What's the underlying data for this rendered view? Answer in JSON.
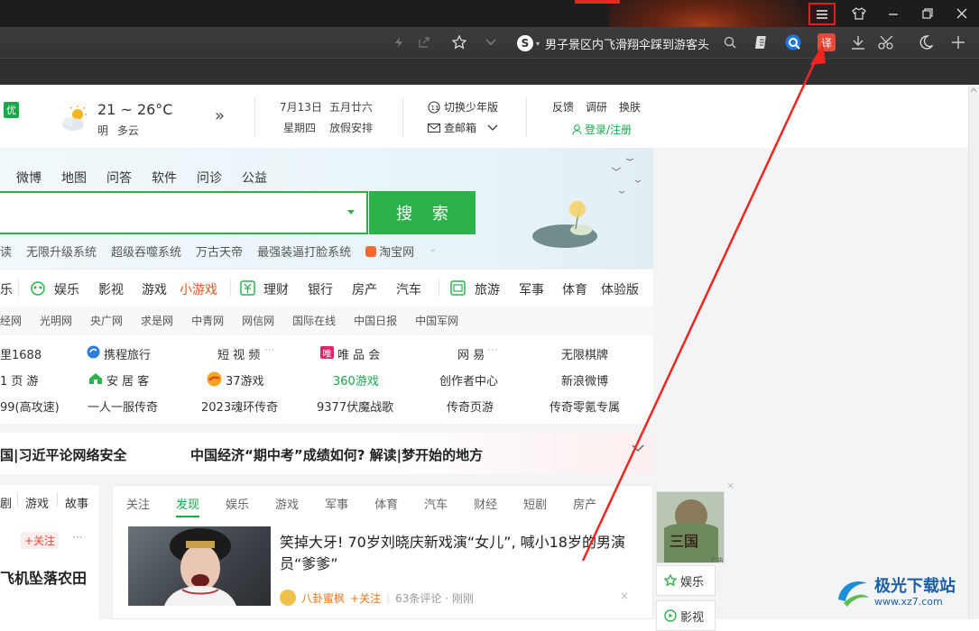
{
  "toolbar": {
    "news_ticker": "男子景区内飞滑翔伞踩到游客头",
    "translate_label": "译"
  },
  "top_info": {
    "badge": "优",
    "temp": "21 ~ 26°C",
    "tomorrow": "明  多云",
    "expand": "»",
    "date": "7月13日",
    "lunar": "五月廿六",
    "weekday": "星期四",
    "suit": "放假安排",
    "teen_mode": "切换少年版",
    "mail": "查邮箱",
    "feedback": "反馈",
    "survey": "调研",
    "skin": "换肤",
    "login": "登录/注册"
  },
  "search": {
    "tabs": [
      "微博",
      "地图",
      "问答",
      "软件",
      "问诊",
      "公益"
    ],
    "button": "搜 索",
    "hot_words": [
      "读",
      "无限升级系统",
      "超级吞噬系统",
      "万古天帝",
      "最强装逼打脸系统",
      "淘宝网"
    ]
  },
  "categories": {
    "c0": "乐",
    "c1": "娱乐",
    "c2": "影视",
    "c3": "游戏",
    "c4": "小游戏",
    "c5": "理财",
    "c6": "银行",
    "c7": "房产",
    "c8": "汽车",
    "c9": "旅游",
    "c10": "军事",
    "c11": "体育",
    "c12": "体验版"
  },
  "media_links": [
    "经网",
    "光明网",
    "央广网",
    "求是网",
    "中青网",
    "网信网",
    "国际在线",
    "中国日报",
    "中国军网"
  ],
  "sites": {
    "r1": [
      "里1688",
      "携程旅行",
      "短 视 频",
      "唯 品 会",
      "网 易",
      "无限棋牌"
    ],
    "r2": [
      "1 页 游",
      "安 居 客",
      "37游戏",
      "360游戏",
      "创作者中心",
      "新浪微博"
    ],
    "r3": [
      "99(高攻速)",
      "一人一服传奇",
      "2023魂环传奇",
      "9377伏魔战歌",
      "传奇页游",
      "传奇零氪专属"
    ]
  },
  "headlines": {
    "h1": "国|习近平论网络安全",
    "h2": "中国经济“期中考”成绩如何? 解读|梦开始的地方"
  },
  "left_col": {
    "tabs": [
      "剧",
      "游戏",
      "故事"
    ],
    "follow": "+关注",
    "more": "···",
    "title": "飞机坠落农田"
  },
  "feed": {
    "tabs": [
      "关注",
      "发现",
      "娱乐",
      "游戏",
      "军事",
      "体育",
      "汽车",
      "财经",
      "短剧",
      "房产"
    ],
    "active_tab": "发现",
    "news_title": "笑掉大牙! 70岁刘晓庆新戏演“女儿”, 喊小18岁的男演员“爹爹”",
    "source": "八卦蜜枫",
    "follow": "+关注",
    "comments": "63条评论 · 刚刚",
    "close": "×"
  },
  "side": {
    "ad_close": "×",
    "ad_label": "广告",
    "b1": "娱乐",
    "b2": "影视"
  },
  "watermark": {
    "name": "极光下载站",
    "url": "www.xz7.com"
  },
  "colors": {
    "accent_green": "#2db24a",
    "highlight_red": "#e02020",
    "titlebar": "#1d1d1f"
  }
}
